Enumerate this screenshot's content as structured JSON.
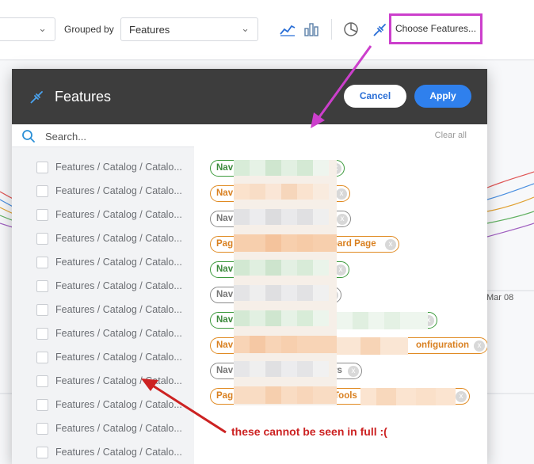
{
  "toolbar": {
    "grouped_by_label": "Grouped by",
    "grouped_by_value": "Features",
    "choose_features_label": "Choose Features...",
    "chart_date": "Mar 08"
  },
  "modal": {
    "title": "Features",
    "cancel_label": "Cancel",
    "apply_label": "Apply",
    "search_placeholder": "Search...",
    "clear_all_label": "Clear all",
    "items": [
      "Features / Catalog / Catalo...",
      "Features / Catalog / Catalo...",
      "Features / Catalog / Catalo...",
      "Features / Catalog / Catalo...",
      "Features / Catalog / Catalo...",
      "Features / Catalog / Catalo...",
      "Features / Catalog / Catalo...",
      "Features / Catalog / Catalo...",
      "Features / Catalog / Catalo...",
      "Features / Catalog / Catalo...",
      "Features / Catalog / Catalo...",
      "Features / Catalog / Catalo...",
      "Features / Catalog / Catalo..."
    ],
    "tags": [
      {
        "prefix": "Nav",
        "suffix": "",
        "color": "green"
      },
      {
        "prefix": "Nav",
        "suffix": "",
        "color": "orange"
      },
      {
        "prefix": "Nav",
        "suffix": "",
        "color": "gray"
      },
      {
        "prefix": "Pag",
        "suffix": "oard Page",
        "color": "orange"
      },
      {
        "prefix": "Nav",
        "suffix": "",
        "color": "green"
      },
      {
        "prefix": "Nav",
        "suffix": "",
        "color": "gray"
      },
      {
        "prefix": "Nav",
        "suffix": "",
        "color": "green"
      },
      {
        "prefix": "Nav",
        "suffix": "onfiguration",
        "color": "orange"
      },
      {
        "prefix": "Nav",
        "suffix": "rs",
        "color": "gray"
      },
      {
        "prefix": "Pag",
        "suffix": "Tools :",
        "color": "orange"
      }
    ],
    "tag_close_glyph": "x"
  },
  "annotation": {
    "text": "these cannot be seen in full :("
  },
  "colors": {
    "highlight_box": "#cc3fcc",
    "arrow_red": "#cc2222",
    "apply_blue": "#2f80ed"
  }
}
